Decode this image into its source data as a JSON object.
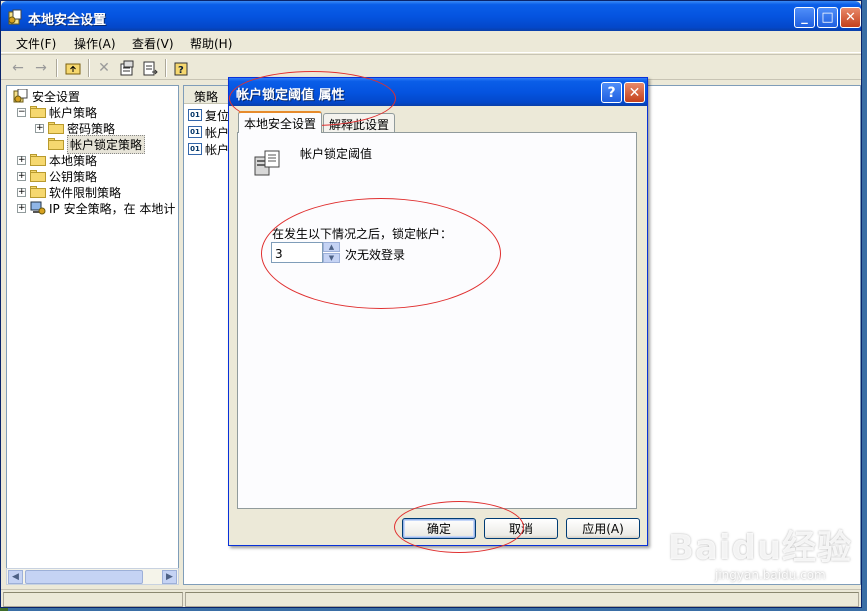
{
  "window": {
    "title": "本地安全设置",
    "buttons": {
      "minimize": "_",
      "maximize": "□",
      "close": "✕"
    }
  },
  "menubar": {
    "items": [
      {
        "label": "文件(F)"
      },
      {
        "label": "操作(A)"
      },
      {
        "label": "查看(V)"
      },
      {
        "label": "帮助(H)"
      }
    ]
  },
  "toolbar": {
    "icons": [
      "back-icon",
      "forward-icon",
      "up-folder-icon",
      "delete-icon",
      "properties-icon",
      "export-icon",
      "help-icon"
    ]
  },
  "tree": {
    "items": [
      {
        "label": "安全设置",
        "level": 0,
        "expander": ""
      },
      {
        "label": "帐户策略",
        "level": 1,
        "expander": "−"
      },
      {
        "label": "密码策略",
        "level": 2,
        "expander": "+"
      },
      {
        "label": "帐户锁定策略",
        "level": 2,
        "expander": ""
      },
      {
        "label": "本地策略",
        "level": 1,
        "expander": "+"
      },
      {
        "label": "公钥策略",
        "level": 1,
        "expander": "+"
      },
      {
        "label": "软件限制策略",
        "level": 1,
        "expander": "+"
      },
      {
        "label": "IP 安全策略，在 本地计",
        "level": 1,
        "expander": "+"
      }
    ]
  },
  "rightpane": {
    "column_header": "策略",
    "rows": [
      {
        "label": "复位"
      },
      {
        "label": "帐户"
      },
      {
        "label": "帐户"
      }
    ]
  },
  "dialog": {
    "title": "帐户锁定阈值 属性",
    "help_button": "?",
    "close_button": "✕",
    "tabs": [
      {
        "label": "本地安全设置",
        "active": true
      },
      {
        "label": "解释此设置",
        "active": false
      }
    ],
    "heading": "帐户锁定阈值",
    "field_label": "在发生以下情况之后，锁定帐户：",
    "field_value": "3",
    "field_unit": "次无效登录",
    "buttons": {
      "ok": "确定",
      "cancel": "取消",
      "apply": "应用(A)"
    }
  },
  "watermark": {
    "brand": "Baidu经验",
    "url": "jingyan.baidu.com"
  },
  "colors": {
    "titlebar": "#0554e0",
    "window_bg": "#ece9d8",
    "annotation": "#e03030"
  }
}
